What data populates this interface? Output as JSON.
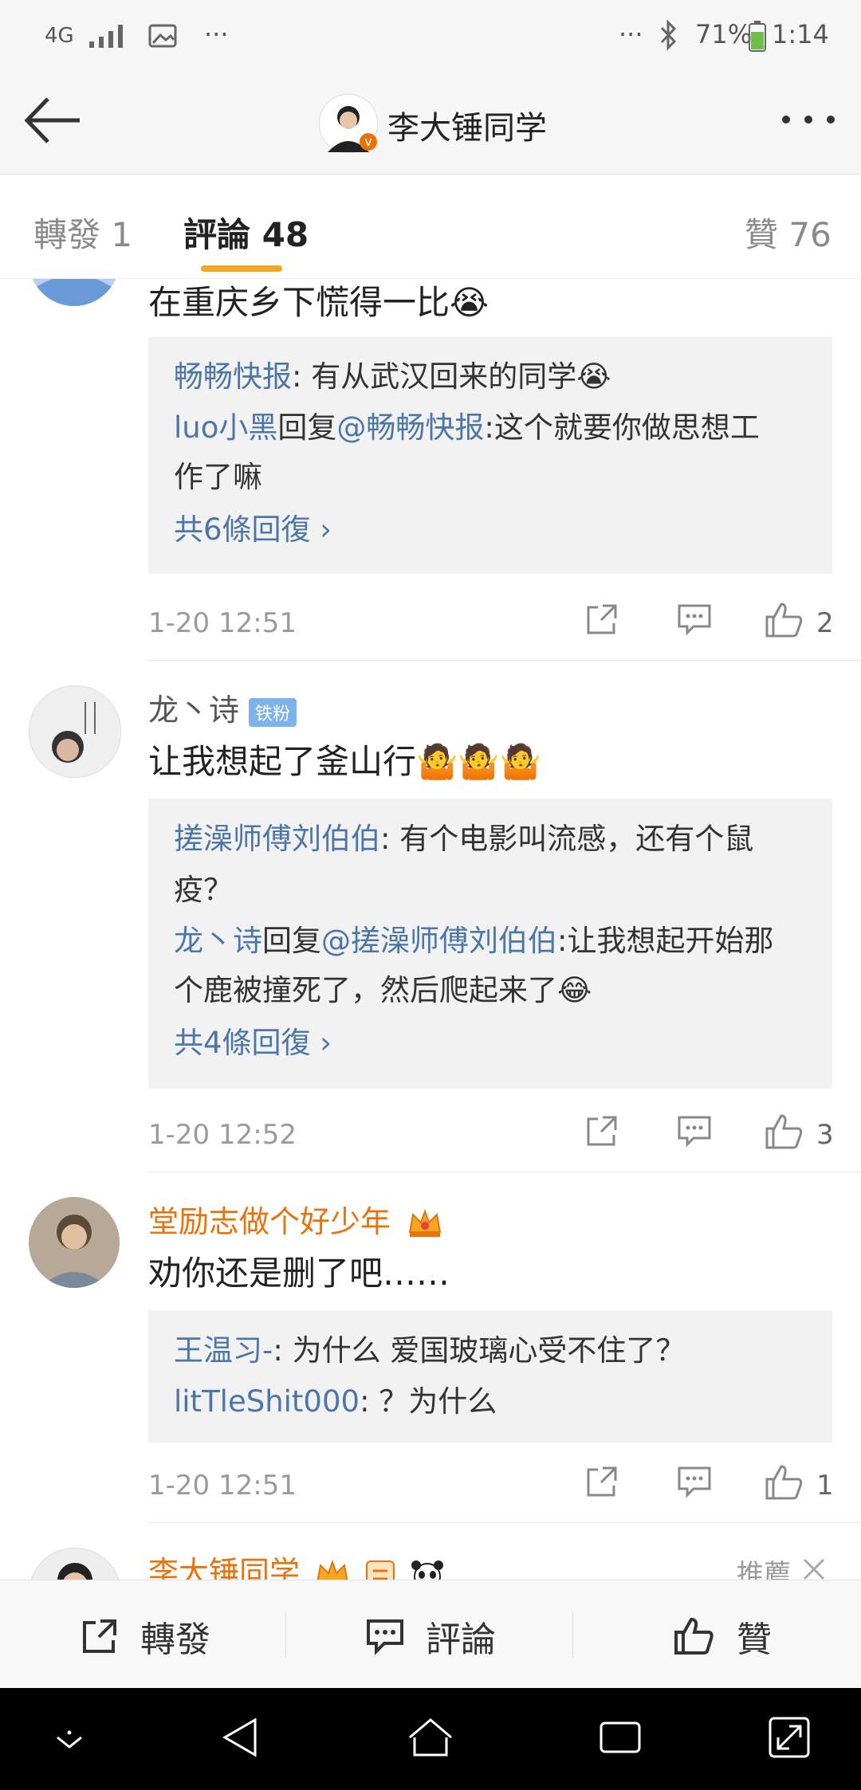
{
  "status_bar": {
    "network": "4G",
    "more_left": "···",
    "more_right": "···",
    "battery_pct": "71%",
    "time": "1:14"
  },
  "header": {
    "title": "李大锤同学",
    "back_icon": "arrow-left-icon",
    "more_icon": "more-dots-icon"
  },
  "tabs": {
    "repost": "轉發 1",
    "comments": "評論 48",
    "likes": "贊 76"
  },
  "comments": [
    {
      "text": "在重庆乡下慌得一比😭",
      "replies": [
        {
          "user": "畅畅快报",
          "sep": ": ",
          "text": "有从武汉回来的同学😭"
        },
        {
          "user": "luo小黑",
          "mid": "回复",
          "target": "@畅畅快报",
          "sep": ":",
          "text": "这个就要你做思想工"
        },
        {
          "text": "作了嘛"
        }
      ],
      "more": "共6條回復 ›",
      "time": "1-20 12:51",
      "likes": "2"
    },
    {
      "user": "龙丶诗",
      "badge": "铁粉",
      "text": "让我想起了釜山行🤷🤷🤷",
      "replies": [
        {
          "user": "搓澡师傅刘伯伯",
          "sep": ": ",
          "text": "有个电影叫流感，还有个鼠"
        },
        {
          "text": "疫？"
        },
        {
          "user": "龙丶诗",
          "mid": "回复",
          "target": "@搓澡师傅刘伯伯",
          "sep": ":",
          "text": "让我想起开始那"
        },
        {
          "text": "个鹿被撞死了，然后爬起来了😂"
        }
      ],
      "more": "共4條回復 ›",
      "time": "1-20 12:52",
      "likes": "3"
    },
    {
      "user": "堂励志做个好少年",
      "text": "劝你还是删了吧……",
      "replies": [
        {
          "user": "王温习-",
          "sep": ": ",
          "text": "为什么  爱国玻璃心受不住了？"
        },
        {
          "user": "litTleShit000",
          "sep": ": ",
          "text": "？为什么"
        }
      ],
      "time": "1-20 12:51",
      "likes": "1"
    },
    {
      "user": "李大锤同学",
      "recommend": "推薦"
    }
  ],
  "bottom_bar": {
    "repost": "轉發",
    "comment": "評論",
    "like": "贊"
  },
  "colors": {
    "link": "#4d76a8",
    "vip_name": "#e8730c",
    "reply_bg": "#f2f2f2",
    "tab_underline": "#f5a623"
  }
}
